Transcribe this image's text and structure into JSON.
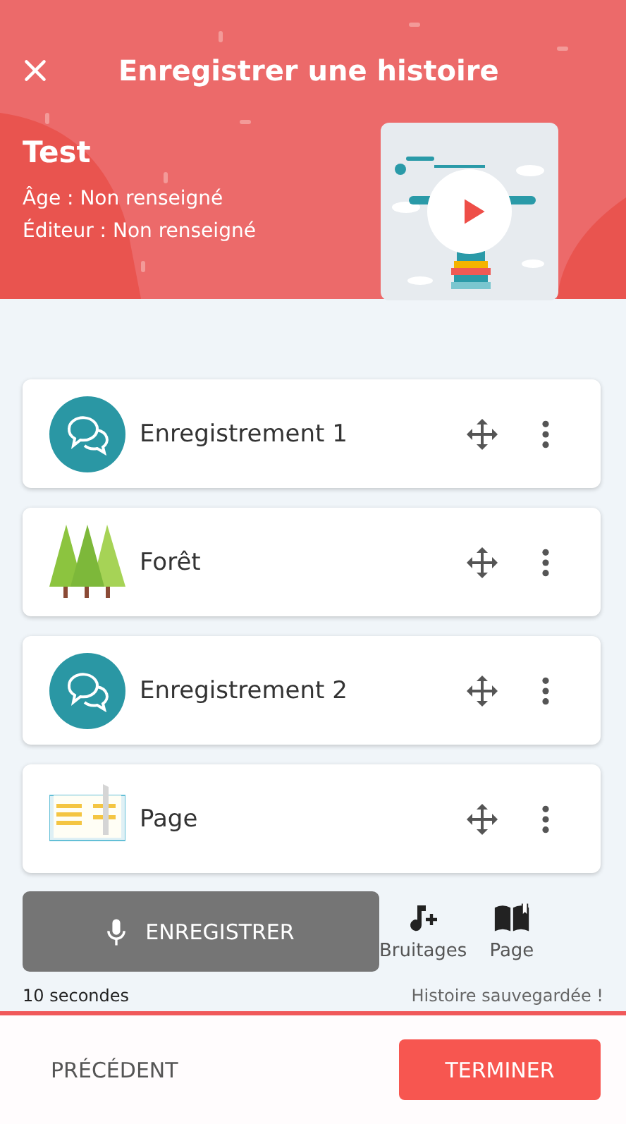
{
  "header": {
    "title": "Enregistrer une histoire",
    "story": {
      "name": "Test",
      "age": "Âge : Non renseigné",
      "publisher": "Éditeur : Non renseigné"
    }
  },
  "items": [
    {
      "kind": "recording",
      "label": "Enregistrement 1"
    },
    {
      "kind": "sound",
      "label": "Forêt"
    },
    {
      "kind": "recording",
      "label": "Enregistrement 2"
    },
    {
      "kind": "page",
      "label": "Page"
    }
  ],
  "controls": {
    "record": "ENREGISTRER",
    "sounds": "Bruitages",
    "page": "Page",
    "duration": "10 secondes",
    "status": "Histoire sauvegardée !"
  },
  "footer": {
    "previous": "PRÉCÉDENT",
    "finish": "TERMINER"
  }
}
